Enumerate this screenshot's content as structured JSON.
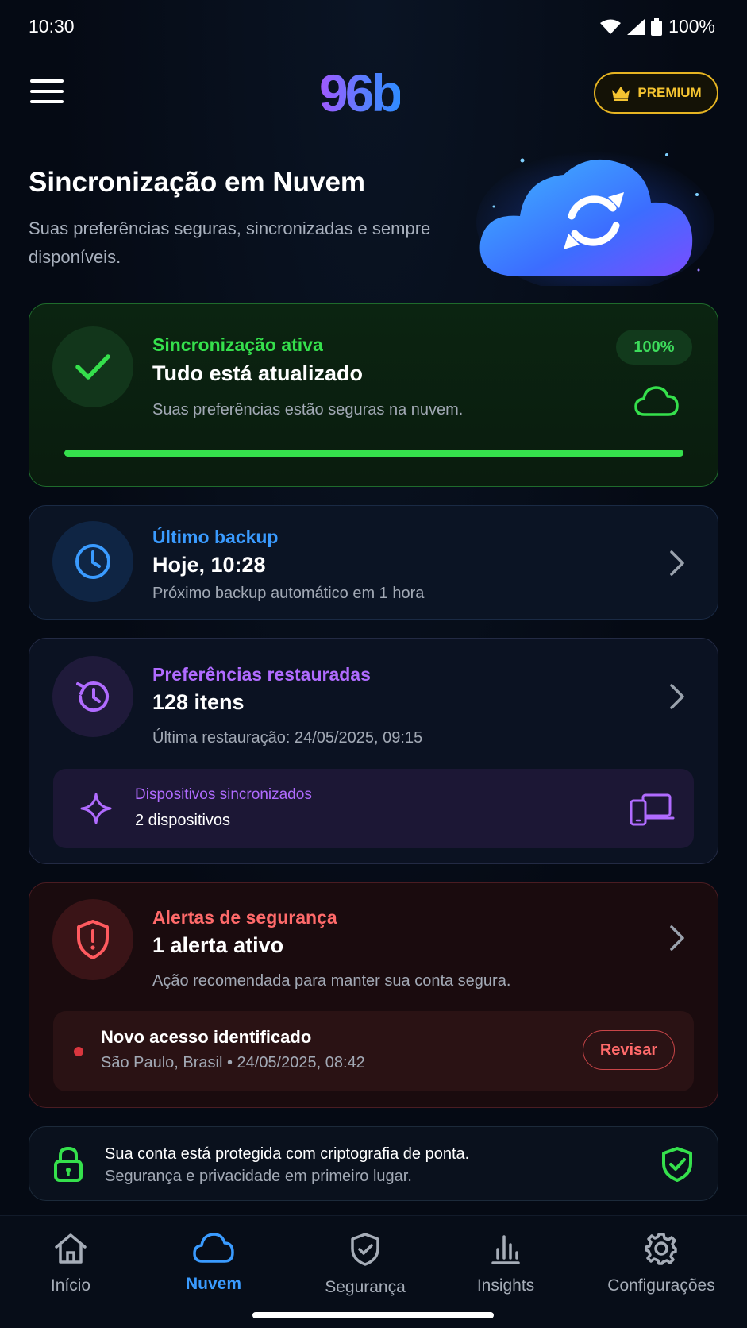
{
  "status_bar": {
    "time": "10:30",
    "battery": "100%"
  },
  "header": {
    "logo": "96b",
    "premium_label": "PREMIUM"
  },
  "hero": {
    "title": "Sincronização em Nuvem",
    "subtitle": "Suas preferências seguras, sincronizadas e sempre disponíveis."
  },
  "sync_card": {
    "label": "Sincronização ativa",
    "value": "Tudo está atualizado",
    "description": "Suas preferências estão seguras na nuvem.",
    "percent": "100%",
    "progress": 1.0
  },
  "backup_card": {
    "label": "Último backup",
    "value": "Hoje, 10:28",
    "description": "Próximo backup automático em 1 hora"
  },
  "prefs_card": {
    "label": "Preferências restauradas",
    "value": "128 itens",
    "description": "Última restauração: 24/05/2025, 09:15",
    "devices": {
      "label": "Dispositivos sincronizados",
      "value": "2 dispositivos"
    }
  },
  "alerts_card": {
    "label": "Alertas de segurança",
    "value": "1 alerta ativo",
    "description": "Ação recomendada para manter sua conta segura.",
    "access": {
      "title": "Novo acesso identificado",
      "detail": "São Paulo, Brasil • 24/05/2025, 08:42",
      "button": "Revisar"
    }
  },
  "lock_card": {
    "line1": "Sua conta está protegida com criptografia de ponta.",
    "line2": "Segurança e privacidade em primeiro lugar."
  },
  "bottom_nav": {
    "items": [
      {
        "label": "Início",
        "icon": "home-icon"
      },
      {
        "label": "Nuvem",
        "icon": "cloud-icon",
        "active": true
      },
      {
        "label": "Segurança",
        "icon": "shield-check-icon"
      },
      {
        "label": "Insights",
        "icon": "bar-chart-icon"
      },
      {
        "label": "Configurações",
        "icon": "gear-icon"
      }
    ]
  },
  "colors": {
    "green": "#35e04c",
    "blue": "#3a9bff",
    "purple": "#b06bff",
    "red": "#ff6a6a",
    "gold": "#f5c431"
  }
}
